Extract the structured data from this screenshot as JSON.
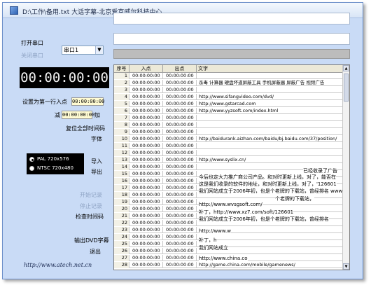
{
  "window": {
    "title": "D:\\工作\\备用.txt 大话字幕-北京爱克威尔科技中心"
  },
  "left": {
    "open_port": "打开串口",
    "close_port": "关闭串口",
    "port_value": "串口1",
    "clock": "00:00:00:00",
    "set_first_in": "设置为第一行入点",
    "first_in_tc": "00:00:00:00",
    "subtract": "减",
    "sub_tc": "00:00:00:00",
    "add": "加",
    "reset_all_tc": "复位全部时间码",
    "font": "字体",
    "import": "导入",
    "export": "导出",
    "format_options": [
      "PAL 720x576",
      "NTSC 720x480"
    ],
    "format_selected": 0,
    "start_record": "开始记录",
    "stop_record": "停止记录",
    "check_tc": "检查时间码",
    "output_dvd": "输出DVD字幕",
    "exit": "退出",
    "url": "http://www.atech.net.cn"
  },
  "grid": {
    "headers": {
      "num": "序号",
      "in": "入点",
      "out": "出点",
      "text": "文字"
    },
    "rows": [
      {
        "num": "1",
        "in": "00:00:00:00",
        "out": "00:00:00:00",
        "text": ""
      },
      {
        "num": "2",
        "in": "00:00:00:00",
        "out": "00:00:00:00",
        "text": "  杀毒  计算器   硬盘坏道屏蔽工具  手机屏蔽器  屏蔽广告  视频广告"
      },
      {
        "num": "3",
        "in": "00:00:00:00",
        "out": "00:00:00:00",
        "text": ""
      },
      {
        "num": "4",
        "in": "00:00:00:00",
        "out": "00:00:00:00",
        "text": "http://www.sifangvideo.com/dvd/"
      },
      {
        "num": "5",
        "in": "00:00:00:00",
        "out": "00:00:00:00",
        "text": "http://www.gstarcad.com"
      },
      {
        "num": "6",
        "in": "00:00:00:00",
        "out": "00:00:00:00",
        "text": "http://www.yyzsoft.com/index.html"
      },
      {
        "num": "7",
        "in": "00:00:00:00",
        "out": "00:00:00:00",
        "text": ""
      },
      {
        "num": "8",
        "in": "00:00:00:00",
        "out": "00:00:00:00",
        "text": ""
      },
      {
        "num": "9",
        "in": "00:00:00:00",
        "out": "00:00:00:00",
        "text": ""
      },
      {
        "num": "10",
        "in": "00:00:00:00",
        "out": "00:00:00:00",
        "text": "http://baidurank.aizhan.com/baidu/bj.baidu.com/37/position/"
      },
      {
        "num": "11",
        "in": "00:00:00:00",
        "out": "00:00:00:00",
        "text": ""
      },
      {
        "num": "12",
        "in": "00:00:00:00",
        "out": "00:00:00:00",
        "text": ""
      },
      {
        "num": "13",
        "in": "00:00:00:00",
        "out": "00:00:00:00",
        "text": "http://www.syslix.cn/"
      },
      {
        "num": "14",
        "in": "00:00:00:00",
        "out": "00:00:00:00",
        "text": ""
      },
      {
        "num": "15",
        "in": "00:00:00:00",
        "out": "00:00:00:00",
        "text": ""
      },
      {
        "num": "16",
        "in": "00:00:00:00",
        "out": "00:00:00:00",
        "text": ""
      },
      {
        "num": "17",
        "in": "00:00:00:00",
        "out": "00:00:00:00",
        "text": ""
      },
      {
        "num": "18",
        "in": "00:00:00:00",
        "out": "00:00:00:00",
        "text": ""
      },
      {
        "num": "19",
        "in": "00:00:00:00",
        "out": "00:00:00:00",
        "text": ""
      },
      {
        "num": "20",
        "in": "00:00:00:00",
        "out": "00:00:00:00",
        "text": ""
      },
      {
        "num": "21",
        "in": "00:00:00:00",
        "out": "00:00:00:00",
        "text": ""
      },
      {
        "num": "22",
        "in": "00:00:00:00",
        "out": "00:00:00:00",
        "text": ""
      },
      {
        "num": "23",
        "in": "00:00:00:00",
        "out": "00:00:00:00",
        "text": ""
      },
      {
        "num": "24",
        "in": "00:00:00:00",
        "out": "00:00:00:00",
        "text": ""
      },
      {
        "num": "25",
        "in": "00:00:00:00",
        "out": "00:00:00:00",
        "text": ""
      },
      {
        "num": "26",
        "in": "00:00:00:00",
        "out": "00:00:00:00",
        "text": ""
      },
      {
        "num": "27",
        "in": "00:00:00:00",
        "out": "00:00:00:00",
        "text": ""
      },
      {
        "num": "28",
        "in": "00:00:00:00",
        "out": "00:00:00:00",
        "text": "http://game.china.com/mobile/gamenews/"
      }
    ],
    "overlays": [
      "已经收录了广告",
      "今后也定大力推广商公司产品。和对时更新上线，对了，能否在",
      "这是我们收录的软件的地址，和对时更新上线，对了，'126601",
      "我们网站成立于2006年初，也是个老牌的下载站，曾经排名 www",
      "个老牌的下载站，",
      "http://www.wvsgsoft.com/",
      "补丁，http://www.xz7.com/soft/126601",
      "我们网站成立于2006年初，也是个老牌的下载站，曾经排名",
      "http://www.w",
      "补丁，h",
      "我们网站成立",
      "http://www.china.co"
    ]
  }
}
